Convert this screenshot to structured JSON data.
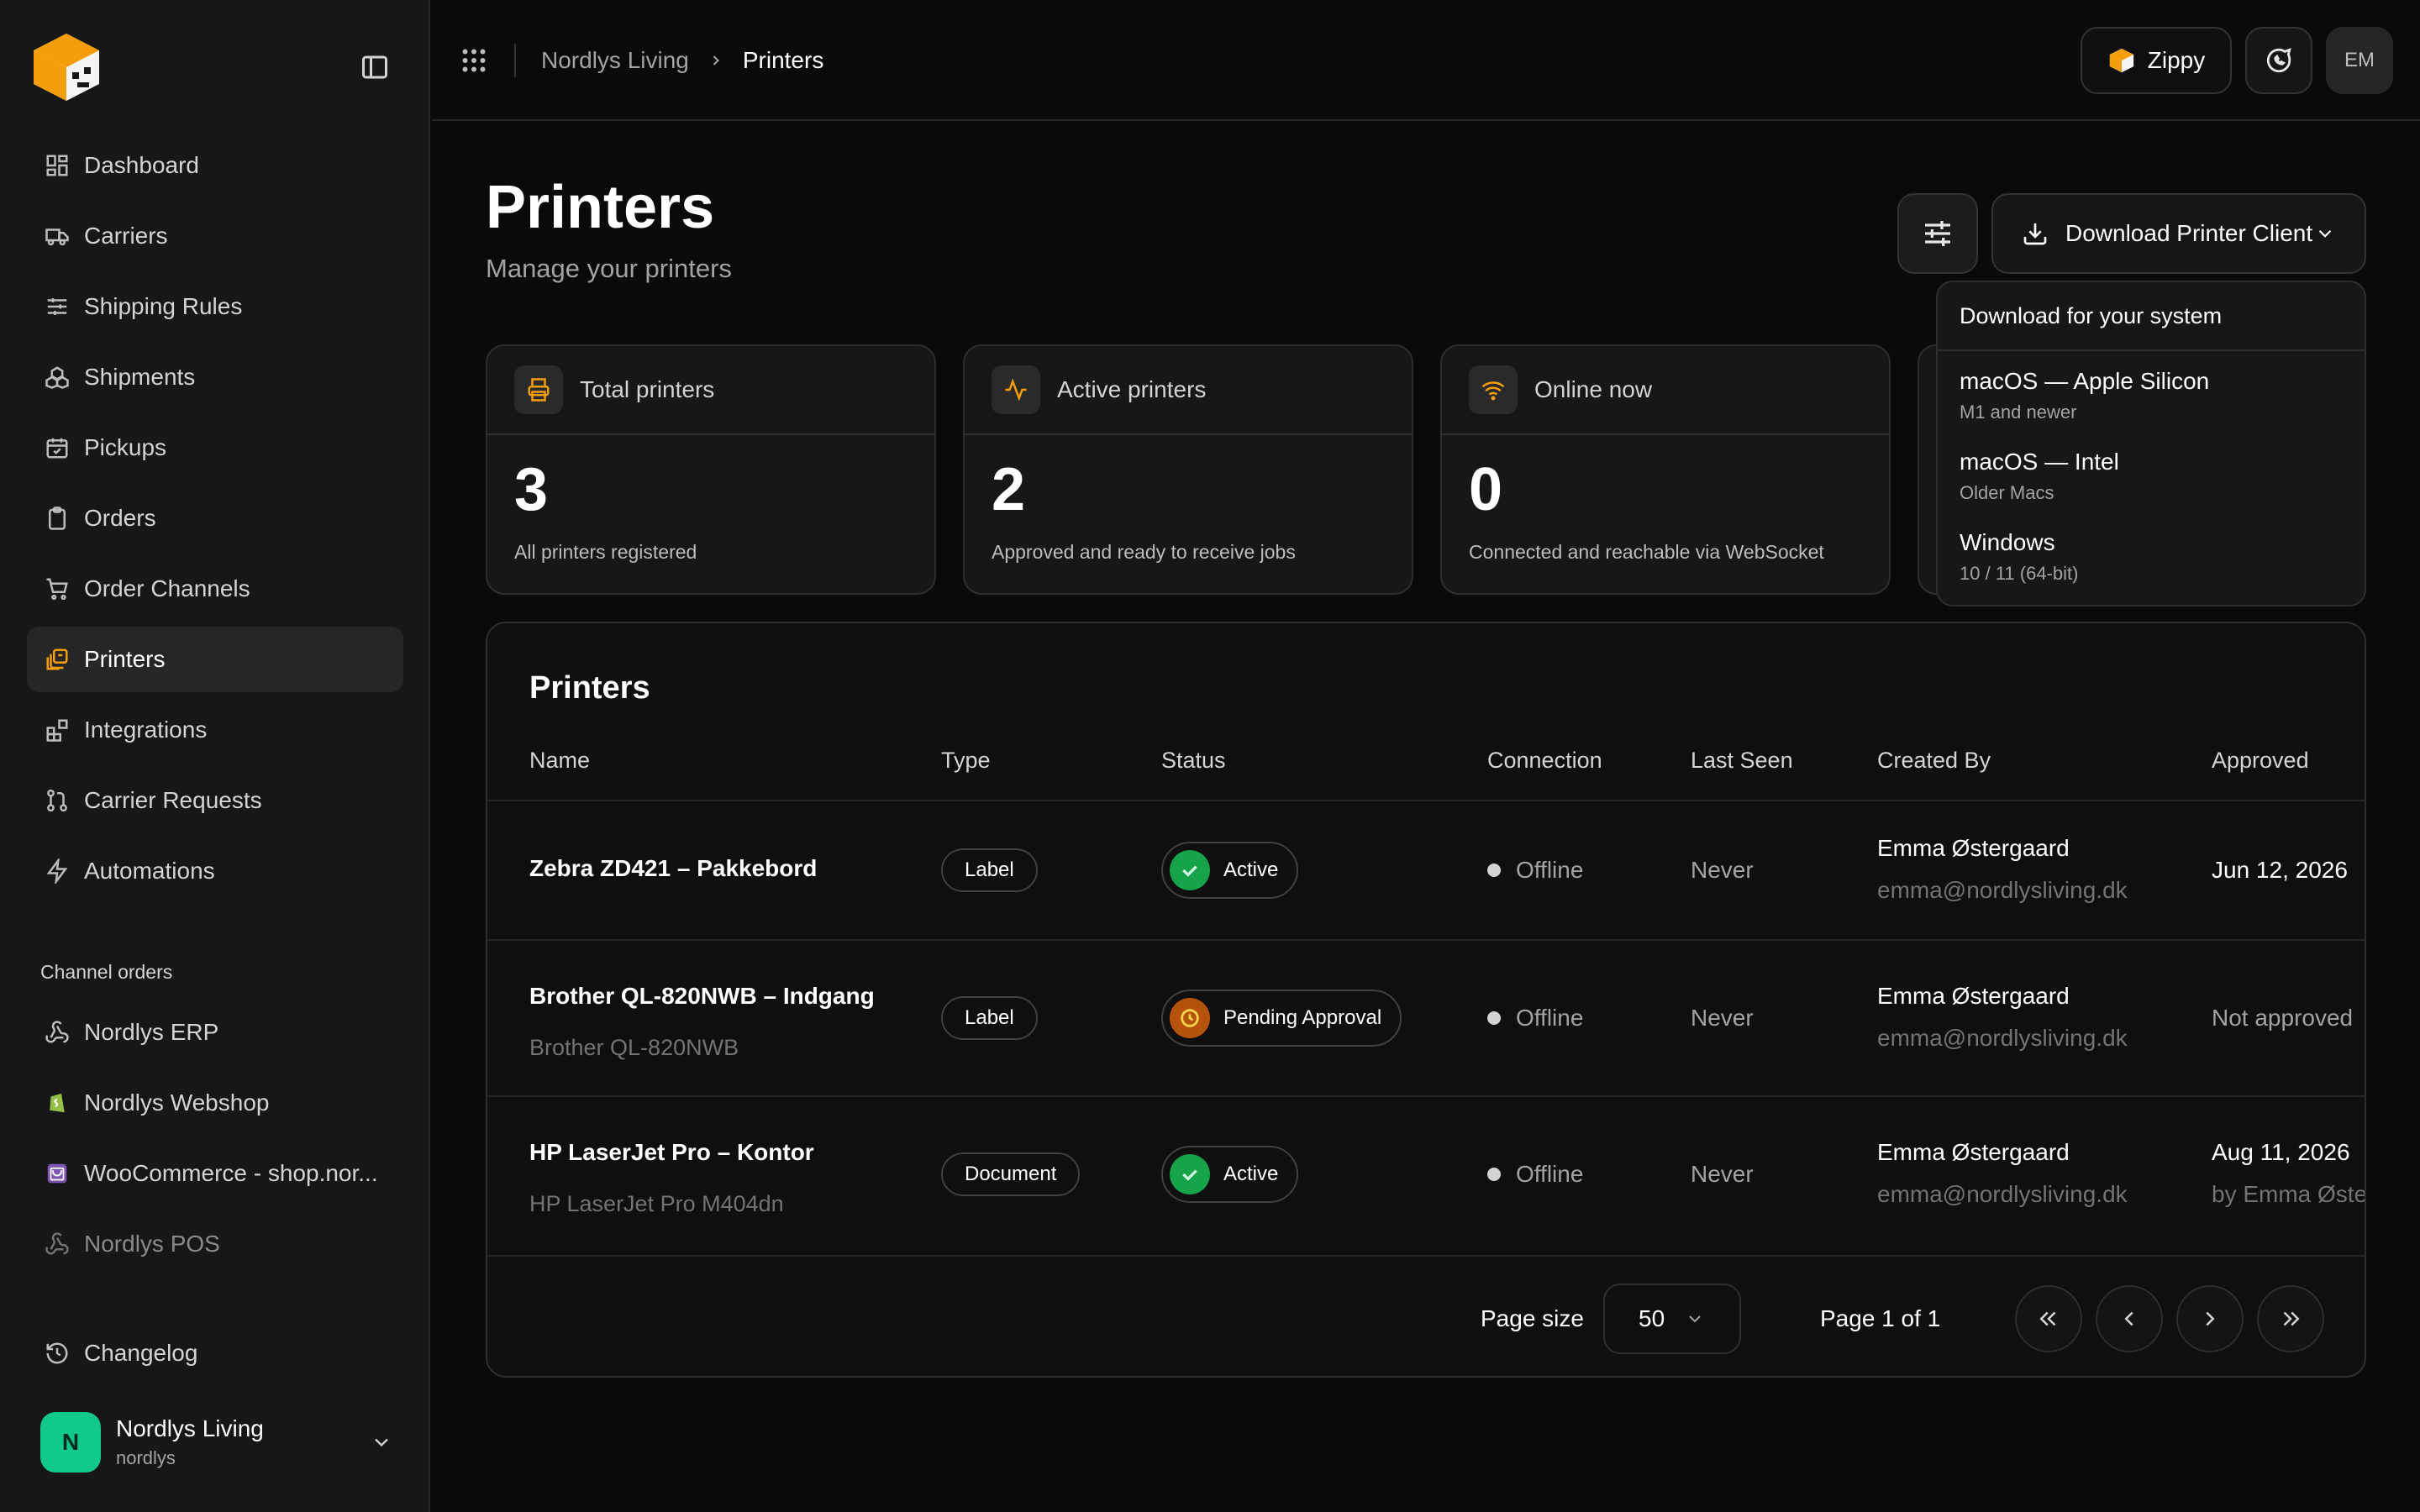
{
  "sidebar": {
    "nav": [
      {
        "label": "Dashboard",
        "icon": "layout-dashboard-icon"
      },
      {
        "label": "Carriers",
        "icon": "truck-icon"
      },
      {
        "label": "Shipping Rules",
        "icon": "sliders-icon"
      },
      {
        "label": "Shipments",
        "icon": "boxes-icon"
      },
      {
        "label": "Pickups",
        "icon": "calendar-check-icon"
      },
      {
        "label": "Orders",
        "icon": "clipboard-icon"
      },
      {
        "label": "Order Channels",
        "icon": "cart-icon"
      },
      {
        "label": "Printers",
        "icon": "printers-icon",
        "active": true
      },
      {
        "label": "Integrations",
        "icon": "blocks-icon"
      },
      {
        "label": "Carrier Requests",
        "icon": "git-pull-request-icon"
      },
      {
        "label": "Automations",
        "icon": "zap-icon"
      }
    ],
    "channels_label": "Channel orders",
    "channels": [
      {
        "label": "Nordlys ERP",
        "icon": "webhook-icon"
      },
      {
        "label": "Nordlys Webshop",
        "icon": "shopify-icon"
      },
      {
        "label": "WooCommerce - shop.nor...",
        "icon": "woocommerce-icon"
      },
      {
        "label": "Nordlys POS",
        "icon": "webhook-icon",
        "dim": true
      }
    ],
    "changelog": "Changelog",
    "account": {
      "initial": "N",
      "name": "Nordlys Living",
      "slug": "nordlys",
      "color": "#10c98a"
    }
  },
  "topbar": {
    "breadcrumb": [
      "Nordlys Living",
      "Printers"
    ],
    "zippy": "Zippy",
    "avatar": "EM"
  },
  "header": {
    "title": "Printers",
    "subtitle": "Manage your printers",
    "download": "Download Printer Client"
  },
  "stats": [
    {
      "label": "Total printers",
      "value": "3",
      "desc": "All printers registered",
      "icon": "printer-icon"
    },
    {
      "label": "Active printers",
      "value": "2",
      "desc": "Approved and ready to receive jobs",
      "icon": "activity-icon"
    },
    {
      "label": "Online now",
      "value": "0",
      "desc": "Connected and reachable via WebSocket",
      "icon": "wifi-icon"
    }
  ],
  "dropdown": {
    "heading": "Download for your system",
    "options": [
      {
        "title": "macOS — Apple Silicon",
        "sub": "M1 and newer"
      },
      {
        "title": "macOS — Intel",
        "sub": "Older Macs"
      },
      {
        "title": "Windows",
        "sub": "10 / 11 (64-bit)"
      }
    ]
  },
  "table": {
    "title": "Printers",
    "columns": [
      "Name",
      "Type",
      "Status",
      "Connection",
      "Last Seen",
      "Created By",
      "Approved"
    ],
    "rows": [
      {
        "name": "Zebra ZD421 – Pakkebord",
        "model": "",
        "type": "Label",
        "status": "Active",
        "connection": "Offline",
        "last_seen": "Never",
        "created_name": "Emma Østergaard",
        "created_email": "emma@nordlysliving.dk",
        "approved": "Jun 12, 2026",
        "approved_by": ""
      },
      {
        "name": "Brother QL-820NWB – Indgang",
        "model": "Brother QL-820NWB",
        "type": "Label",
        "status": "Pending Approval",
        "connection": "Offline",
        "last_seen": "Never",
        "created_name": "Emma Østergaard",
        "created_email": "emma@nordlysliving.dk",
        "approved": "Not approved",
        "approved_by": ""
      },
      {
        "name": "HP LaserJet Pro – Kontor",
        "model": "HP LaserJet Pro M404dn",
        "type": "Document",
        "status": "Active",
        "connection": "Offline",
        "last_seen": "Never",
        "created_name": "Emma Østergaard",
        "created_email": "emma@nordlysliving.dk",
        "approved": "Aug 11, 2026",
        "approved_by": "by Emma Øste"
      }
    ]
  },
  "pagination": {
    "page_size_label": "Page size",
    "page_size": "50",
    "page_of": "Page 1 of 1"
  },
  "colors": {
    "accent": "#f59e0b",
    "active": "#16a34a",
    "pending": "#d97706",
    "background": "#0a0a0a"
  }
}
